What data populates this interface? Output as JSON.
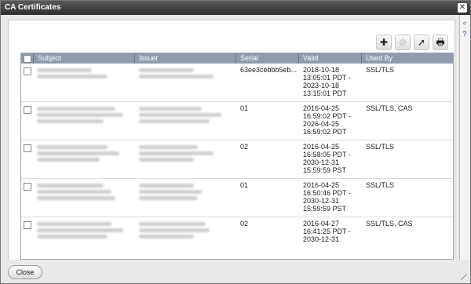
{
  "window": {
    "title": "CA Certificates",
    "close_glyph": "✕"
  },
  "side": {
    "collapse_glyph": "«",
    "help_glyph": "?"
  },
  "toolbar": {
    "buttons": [
      {
        "icon": "plus-icon",
        "glyph": "✚"
      },
      {
        "icon": "disable-icon",
        "glyph": "⊘"
      },
      {
        "icon": "export-icon",
        "glyph": "➚"
      },
      {
        "icon": "printer-icon",
        "glyph": "🖶"
      }
    ]
  },
  "table": {
    "headers": [
      "Subject",
      "Issuer",
      "Serial",
      "Valid",
      "Used By"
    ],
    "rows": [
      {
        "serial": "63ee3cebbb5eb...",
        "valid": [
          "2018-10-18",
          "13:05:01 PDT -",
          "2023-10-18",
          "13:15:01 PDT"
        ],
        "used_by": "SSL/TLS"
      },
      {
        "serial": "01",
        "valid": [
          "2016-04-25",
          "16:59:02 PDT -",
          "2026-04-25",
          "16:59:02 PDT"
        ],
        "used_by": "SSL/TLS, CAS"
      },
      {
        "serial": "02",
        "valid": [
          "2016-04-25",
          "16:58:05 PDT -",
          "2030-12-31",
          "15:59:59 PST"
        ],
        "used_by": "SSL/TLS"
      },
      {
        "serial": "01",
        "valid": [
          "2016-04-25",
          "16:50:46 PDT -",
          "2030-12-31",
          "15:59:59 PST"
        ],
        "used_by": "SSL/TLS"
      },
      {
        "serial": "02",
        "valid": [
          "2016-04-27",
          "16:41:25 PDT -",
          "2030-12-31",
          ""
        ],
        "used_by": "SSL/TLS, CAS"
      }
    ]
  },
  "footer": {
    "close_label": "Close"
  }
}
